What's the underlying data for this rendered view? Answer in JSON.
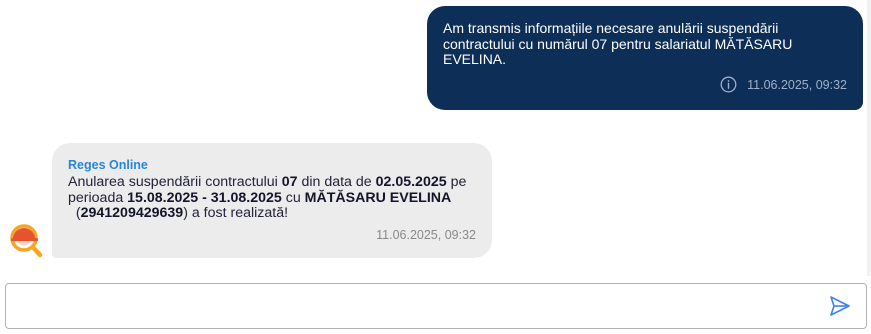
{
  "messages": {
    "outgoing": {
      "text": "Am transmis informațiile necesare anulării suspendării contractului cu numărul 07 pentru salariatul MĂTĂSARU EVELINA.",
      "timestamp": "11.06.2025, 09:32",
      "icon": "info-icon"
    },
    "incoming": {
      "sender": "Reges Online",
      "parts": {
        "p1": "Anularea suspendării contractului ",
        "contract_number": "07",
        "p2": " din data de ",
        "date": "02.05.2025",
        "p3": " pe perioada ",
        "period": "15.08.2025 - 31.08.2025",
        "p4": " cu ",
        "employee": "MĂTĂSARU EVELINA",
        "p5": "  (",
        "cnp": "2941209429639",
        "p6": ") a fost realizată!"
      },
      "timestamp": "11.06.2025, 09:32",
      "avatar_icon": "reges-logo-icon"
    }
  },
  "composer": {
    "value": "",
    "placeholder": "",
    "send_icon": "send-icon"
  },
  "colors": {
    "outgoing_bubble": "#0d2e57",
    "incoming_bubble": "#ececec",
    "sender_name": "#2a86d9",
    "logo_primary": "#e8532f",
    "logo_secondary": "#f5a623",
    "send_icon": "#3b82f6"
  }
}
